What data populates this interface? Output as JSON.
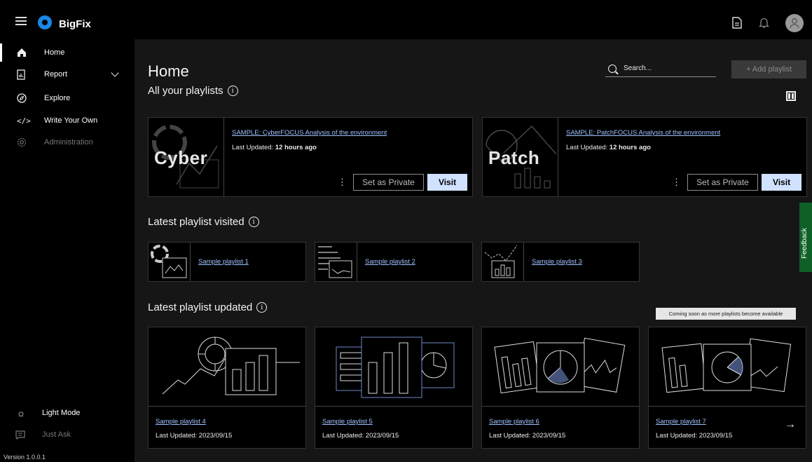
{
  "app": {
    "brand": "BigFix",
    "version": "Version 1.0.0.1"
  },
  "topbar": {
    "icons": [
      "document-icon",
      "bell-icon",
      "user-avatar-icon"
    ]
  },
  "sidebar": {
    "items": [
      {
        "label": "Home",
        "icon": "home-icon"
      },
      {
        "label": "Report",
        "icon": "report-icon"
      },
      {
        "label": "Explore",
        "icon": "compass-icon"
      },
      {
        "label": "Write Your Own",
        "icon": "code-icon"
      },
      {
        "label": "Administration",
        "icon": "gear-icon"
      }
    ],
    "bottom": [
      {
        "label": "Light Mode",
        "icon": "sun-icon"
      },
      {
        "label": "Just Ask",
        "icon": "chat-icon"
      }
    ]
  },
  "main": {
    "title": "Home",
    "search_placeholder": "Search...",
    "add_playlist": "+ Add playlist",
    "all_playlists_title": "All your playlists",
    "featured": [
      {
        "word": "Cyber",
        "title": "SAMPLE: CyberFOCUS Analysis of the environment",
        "updated_prefix": "Last Updated: ",
        "updated_value": "12 hours ago",
        "private_label": "Set as Private",
        "visit_label": "Visit"
      },
      {
        "word": "Patch",
        "title": "SAMPLE: PatchFOCUS Analysis of the environment",
        "updated_prefix": "Last Updated: ",
        "updated_value": "12 hours ago",
        "private_label": "Set as Private",
        "visit_label": "Visit"
      }
    ],
    "visited_title": "Latest playlist visited",
    "visited": [
      {
        "label": "Sample playlist 1"
      },
      {
        "label": "Sample playlist 2"
      },
      {
        "label": "Sample playlist 3"
      }
    ],
    "updated_title": "Latest playlist updated",
    "tooltip": "Coming soon as more playlists become available",
    "updated": [
      {
        "label": "Sample playlist 4",
        "meta": "Last Updated: 2023/09/15"
      },
      {
        "label": "Sample playlist 5",
        "meta": "Last Updated: 2023/09/15"
      },
      {
        "label": "Sample playlist 6",
        "meta": "Last Updated: 2023/09/15"
      },
      {
        "label": "Sample playlist 7",
        "meta": "Last Updated: 2023/09/15"
      }
    ]
  },
  "feedback": {
    "label": "Feedback"
  },
  "colors": {
    "accent": "#d0e2ff",
    "link": "#9ec1ff",
    "feedback": "#0e6027",
    "background": "#161616"
  }
}
